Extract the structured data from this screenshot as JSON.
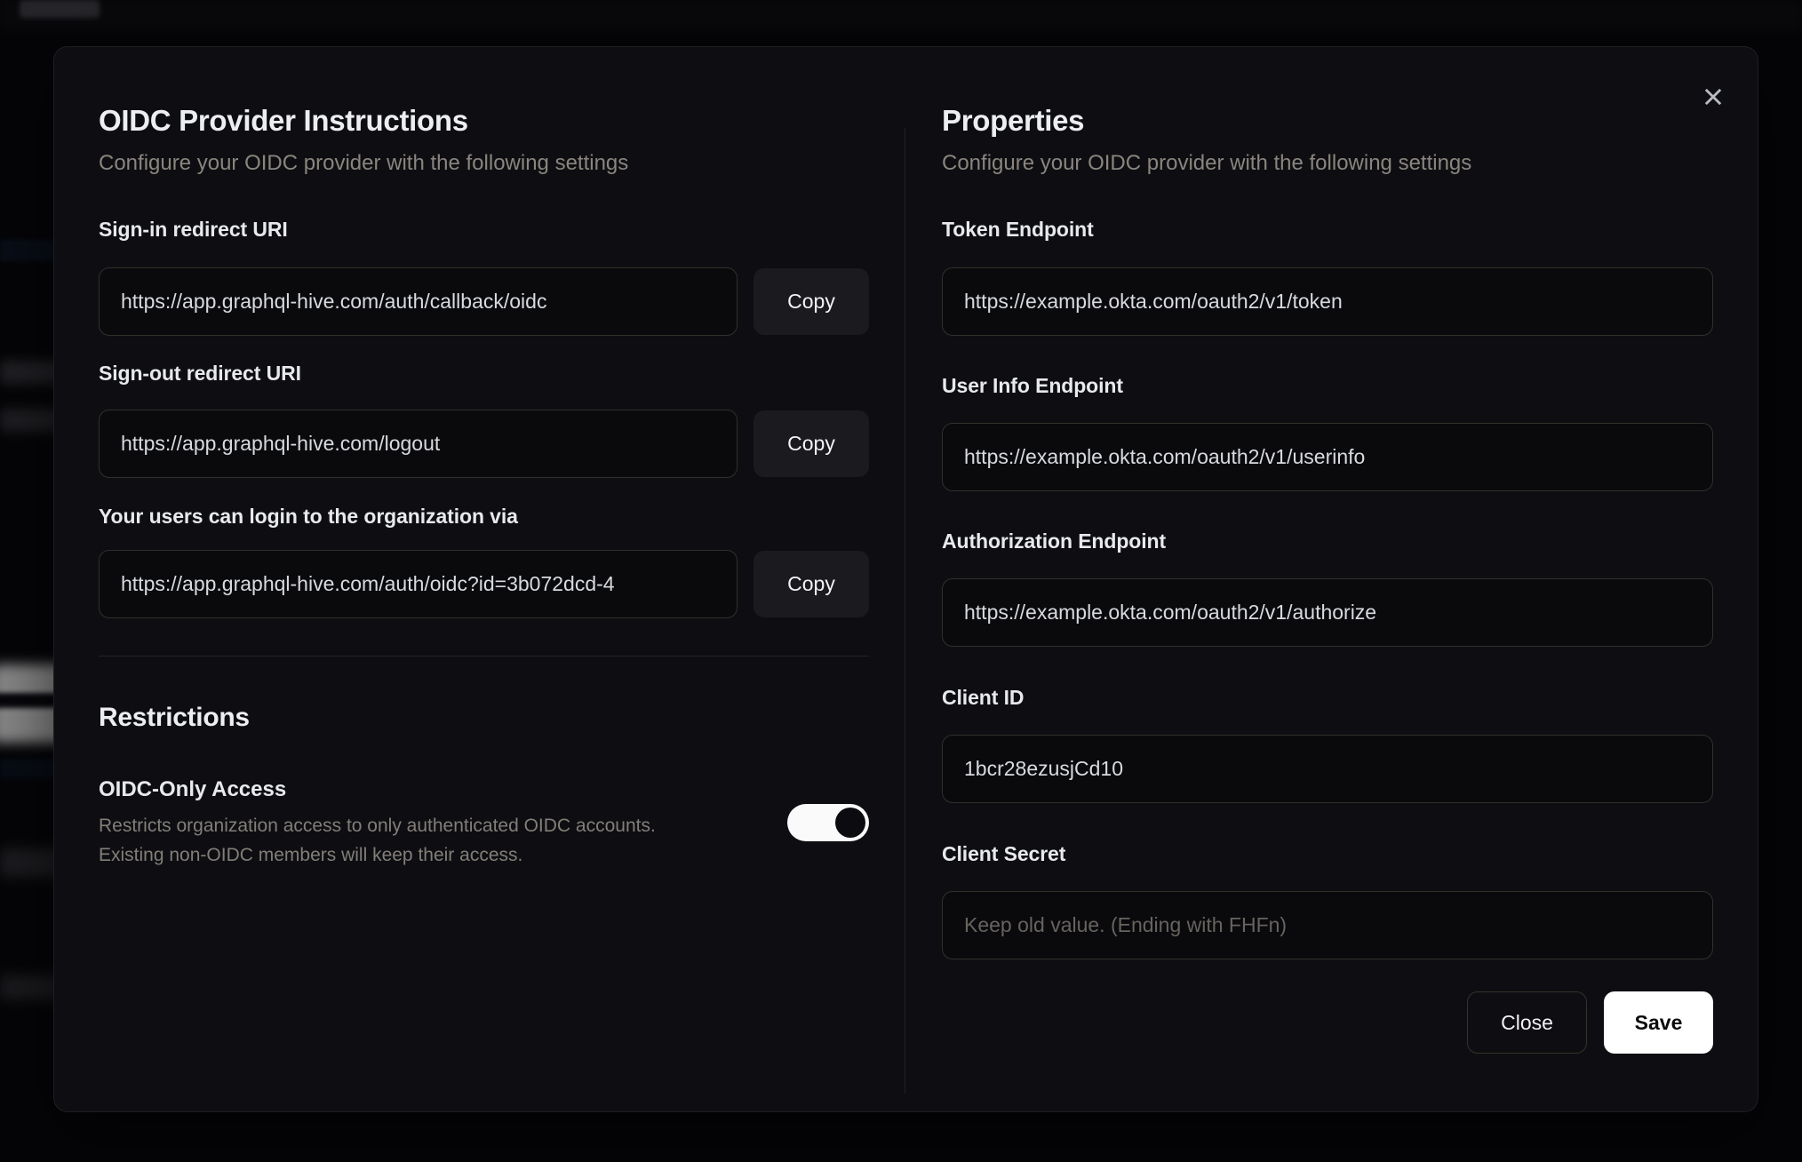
{
  "modal": {
    "close_icon": "x",
    "left": {
      "title": "OIDC Provider Instructions",
      "subtitle": "Configure your OIDC provider with the following settings",
      "fields": [
        {
          "label": "Sign-in redirect URI",
          "value": "https://app.graphql-hive.com/auth/callback/oidc",
          "button": "Copy"
        },
        {
          "label": "Sign-out redirect URI",
          "value": "https://app.graphql-hive.com/logout",
          "button": "Copy"
        },
        {
          "label": "Your users can login to the organization via",
          "value": "https://app.graphql-hive.com/auth/oidc?id=3b072dcd-4",
          "button": "Copy"
        }
      ],
      "restrictions": {
        "title": "Restrictions",
        "toggle_label": "OIDC-Only Access",
        "toggle_description_line1": "Restricts organization access to only authenticated OIDC accounts.",
        "toggle_description_line2": "Existing non-OIDC members will keep their access.",
        "toggle_state": "on"
      }
    },
    "right": {
      "title": "Properties",
      "subtitle": "Configure your OIDC provider with the following settings",
      "fields": [
        {
          "label": "Token Endpoint",
          "value": "https://example.okta.com/oauth2/v1/token"
        },
        {
          "label": "User Info Endpoint",
          "value": "https://example.okta.com/oauth2/v1/userinfo"
        },
        {
          "label": "Authorization Endpoint",
          "value": "https://example.okta.com/oauth2/v1/authorize"
        },
        {
          "label": "Client ID",
          "value": "1bcr28ezusjCd10"
        },
        {
          "label": "Client Secret",
          "value": "",
          "placeholder": "Keep old value. (Ending with FHFn)"
        }
      ],
      "buttons": {
        "close": "Close",
        "save": "Save"
      }
    }
  },
  "colors": {
    "modal_background": "#0e0e12",
    "page_background": "#07070a",
    "input_border": "#322f2a",
    "copy_button_background": "#1b1b1f",
    "save_button_background": "#ffffff",
    "toggle_track_on": "#fafafa",
    "toggle_knob": "#0c0c10",
    "muted_text": "#8a857e"
  }
}
